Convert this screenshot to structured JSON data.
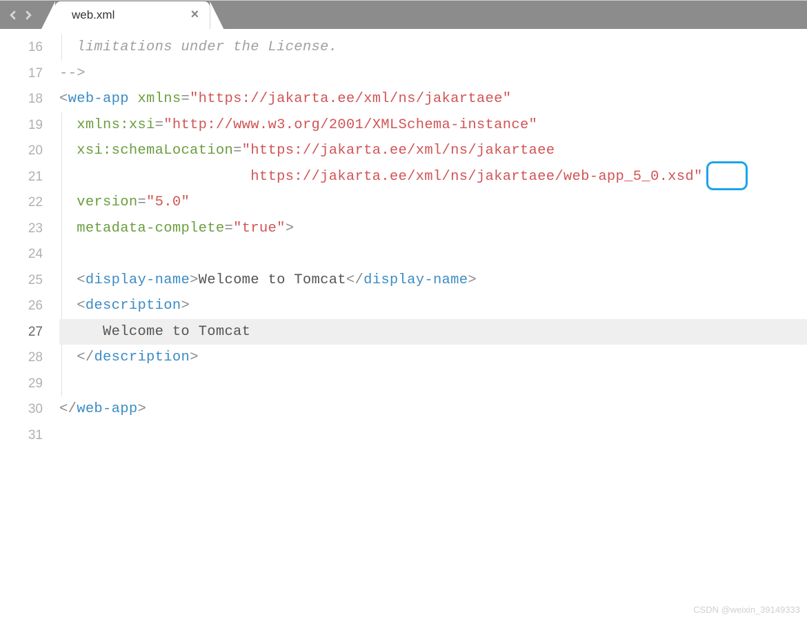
{
  "tab": {
    "title": "web.xml"
  },
  "lines": {
    "16": "16",
    "17": "17",
    "18": "18",
    "19": "19",
    "20": "20",
    "21": "21",
    "22": "22",
    "23": "23",
    "24": "24",
    "25": "25",
    "26": "26",
    "27": "27",
    "28": "28",
    "29": "29",
    "30": "30",
    "31": "31"
  },
  "code": {
    "comment_text": "  limitations under the License.",
    "comment_close": "-->",
    "web_app_tag": "web-app",
    "xmlns_attr": "xmlns",
    "xmlns_val": "https://jakarta.ee/xml/ns/jakartaee",
    "xmlns_xsi_attr": "xmlns:xsi",
    "xmlns_xsi_val": "http://www.w3.org/2001/XMLSchema-instance",
    "schema_loc_attr": "xsi:schemaLocation",
    "schema_loc_val1": "https://jakarta.ee/xml/ns/jakartaee",
    "schema_loc_val2a": "                      https://jakarta.ee/xml/ns/jakartaee/web-app",
    "schema_loc_val2b": "_5_0",
    "schema_loc_val2c": ".xsd",
    "version_attr": "version",
    "version_val": "5.0",
    "metadata_attr": "metadata-complete",
    "metadata_val": "true",
    "display_name_tag": "display-name",
    "display_name_text": "Welcome to Tomcat",
    "description_tag": "description",
    "description_text": "     Welcome to Tomcat"
  },
  "watermark": "CSDN @weixin_39149333"
}
